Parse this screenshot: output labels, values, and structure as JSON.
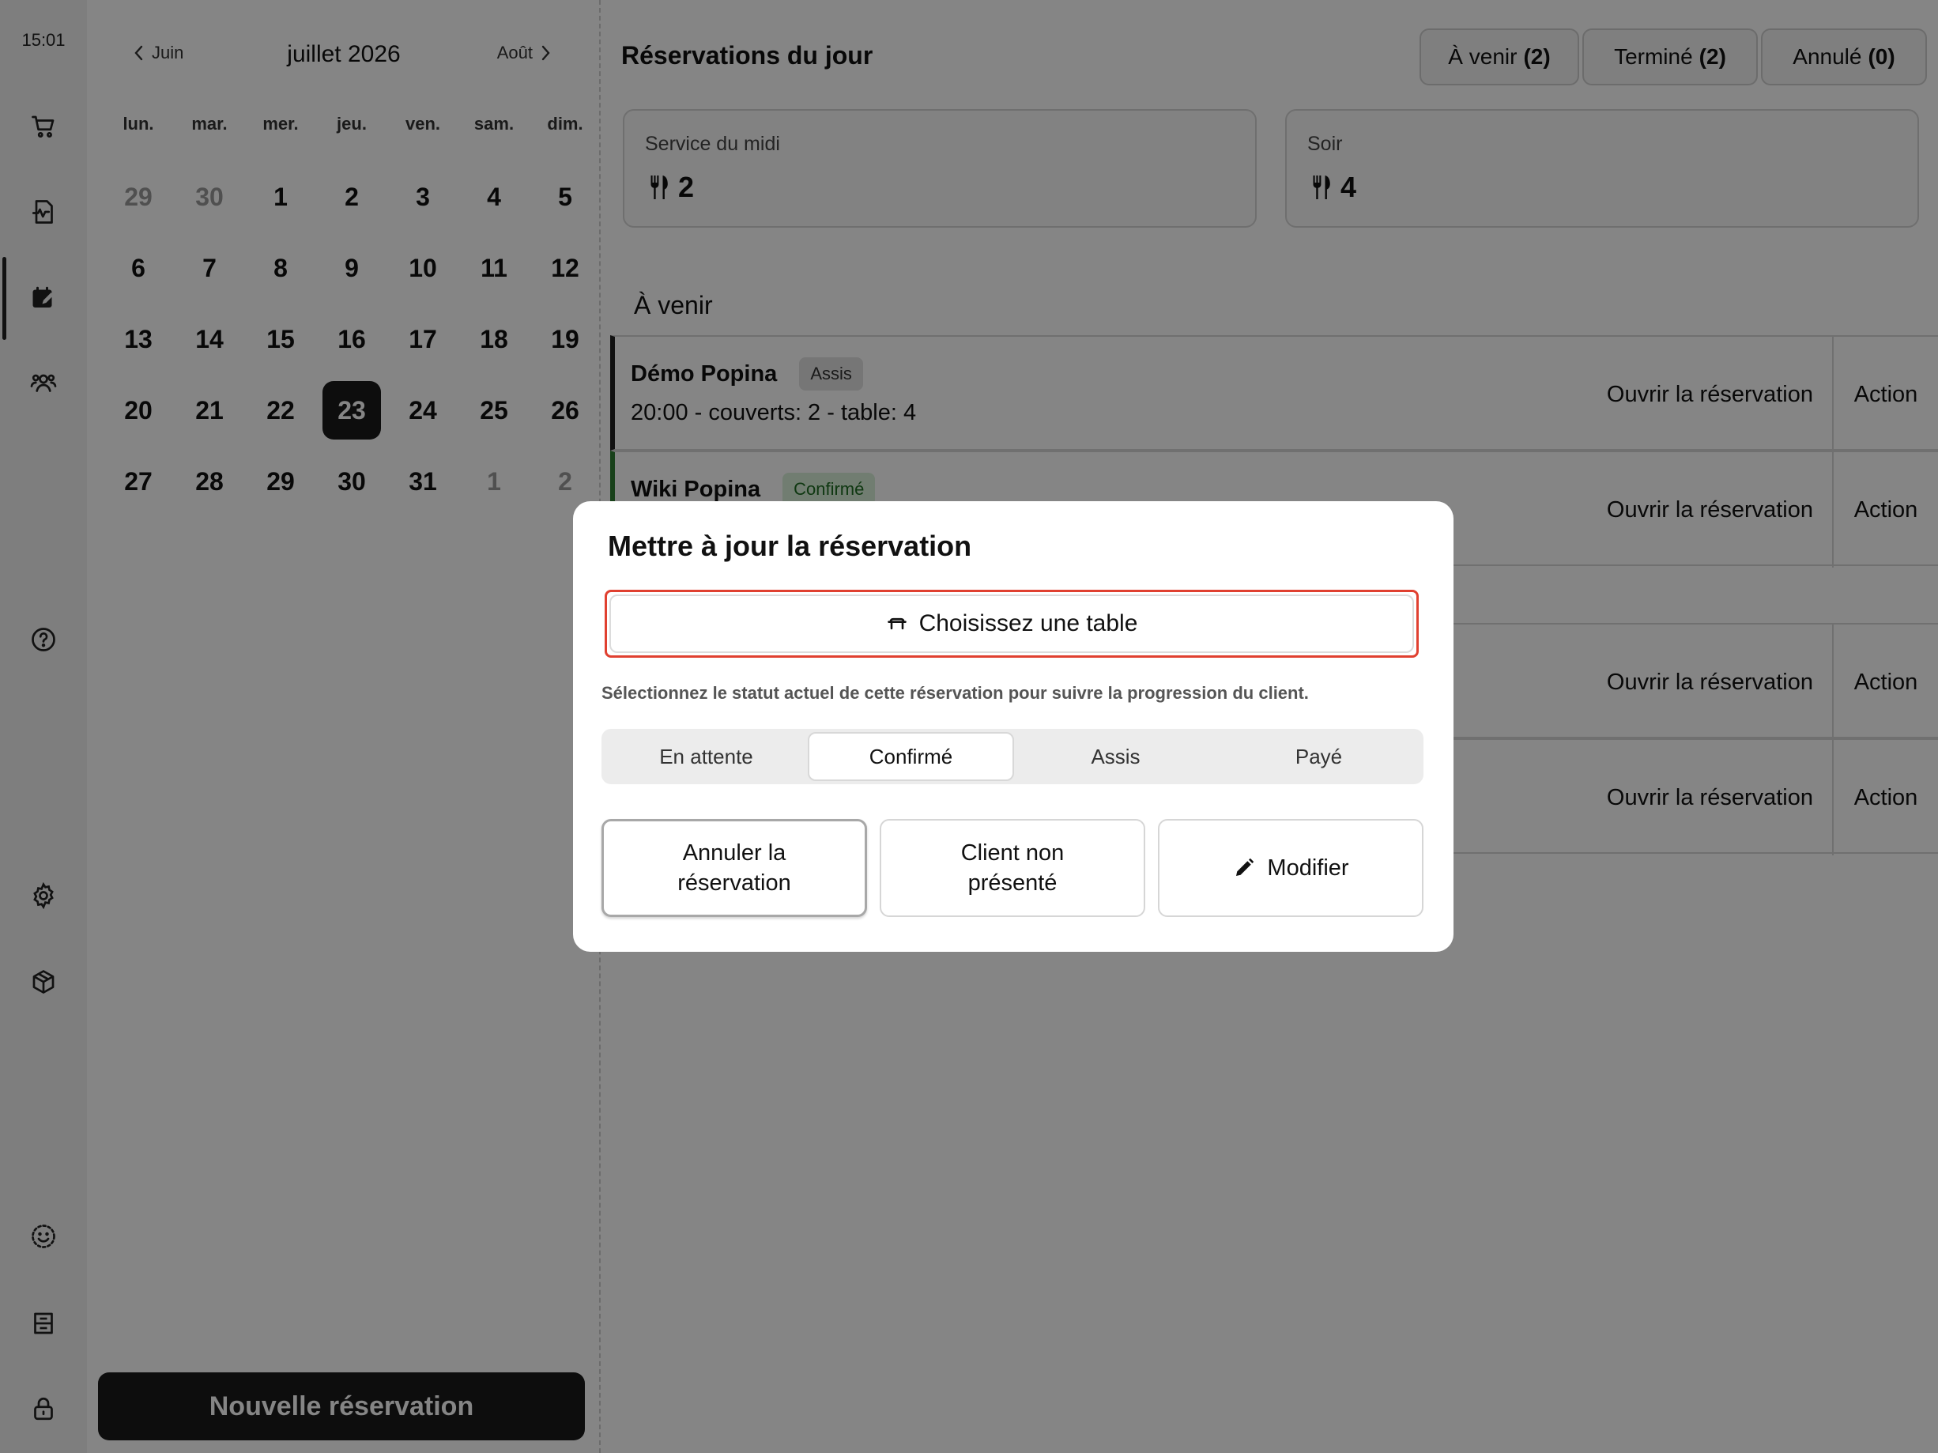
{
  "rail": {
    "time": "15:01"
  },
  "calendar": {
    "prev_label": "Juin",
    "next_label": "Août",
    "month_title": "juillet 2026",
    "weekdays": [
      "lun.",
      "mar.",
      "mer.",
      "jeu.",
      "ven.",
      "sam.",
      "dim."
    ],
    "days": [
      "29",
      "30",
      "1",
      "2",
      "3",
      "4",
      "5",
      "6",
      "7",
      "8",
      "9",
      "10",
      "11",
      "12",
      "13",
      "14",
      "15",
      "16",
      "17",
      "18",
      "19",
      "20",
      "21",
      "22",
      "23",
      "24",
      "25",
      "26",
      "27",
      "28",
      "29",
      "30",
      "31",
      "1",
      "2"
    ],
    "selected_day": "23",
    "new_button": "Nouvelle réservation"
  },
  "main": {
    "title": "Réservations du jour",
    "filters": [
      {
        "label": "À venir",
        "count": "(2)"
      },
      {
        "label": "Terminé",
        "count": "(2)"
      },
      {
        "label": "Annulé",
        "count": "(0)"
      }
    ],
    "services": [
      {
        "label": "Service du midi",
        "value": "2"
      },
      {
        "label": "Soir",
        "value": "4"
      }
    ],
    "section_title": "À venir",
    "reservations": [
      {
        "name": "Démo Popina",
        "badge": "Assis",
        "detail": "20:00 - couverts: 2  - table: 4",
        "open": "Ouvrir la réservation",
        "action": "Action"
      },
      {
        "name": "Wiki Popina",
        "badge": "Confirmé",
        "open": "Ouvrir la réservation",
        "action": "Action"
      },
      {
        "open": "Ouvrir la réservation",
        "action": "Action"
      },
      {
        "open": "Ouvrir la réservation",
        "action": "Action"
      }
    ]
  },
  "modal": {
    "title": "Mettre à jour la réservation",
    "choose_table": "Choisissez une table",
    "help": "Sélectionnez le statut actuel de cette réservation pour suivre la progression du client.",
    "statuses": [
      "En attente",
      "Confirmé",
      "Assis",
      "Payé"
    ],
    "active_status": "Confirmé",
    "cancel_line1": "Annuler la",
    "cancel_line2": "réservation",
    "noshow_line1": "Client non",
    "noshow_line2": "présenté",
    "edit": "Modifier"
  }
}
